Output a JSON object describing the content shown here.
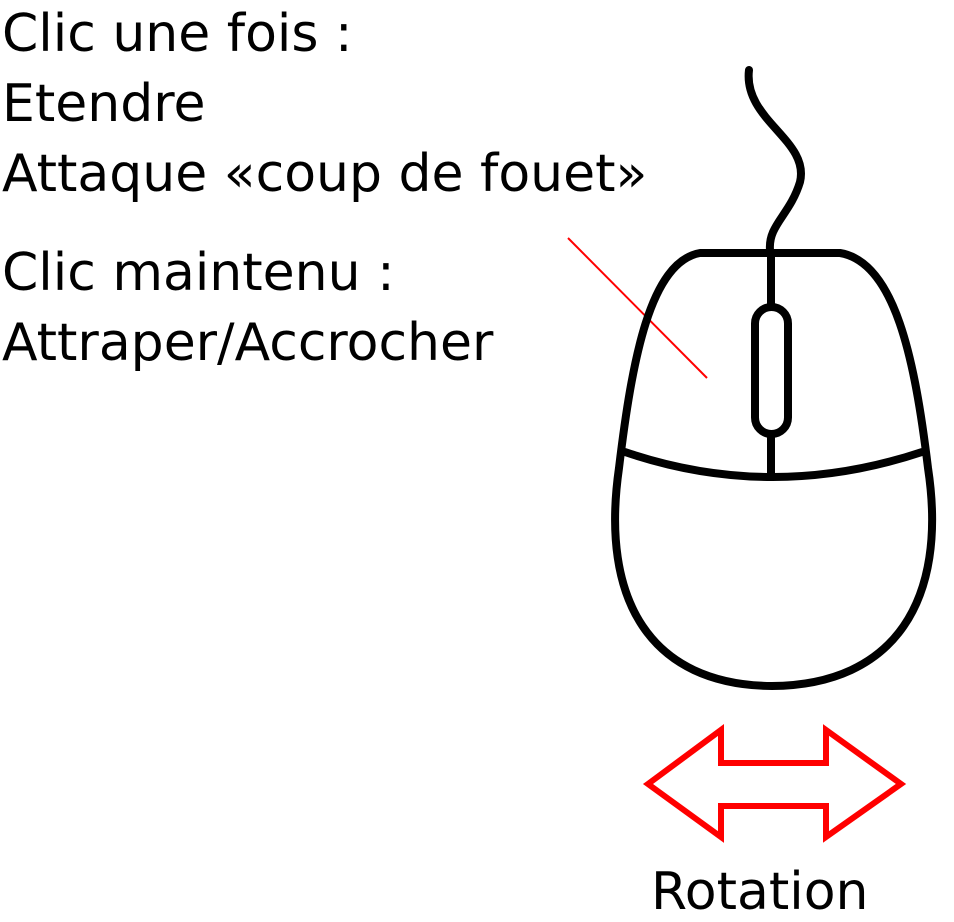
{
  "left_click": {
    "single": {
      "title": "Clic une fois :",
      "action1": "Etendre",
      "action2": "Attaque «coup de fouet»"
    },
    "hold": {
      "title": "Clic maintenu :",
      "action": "Attraper/Accrocher"
    }
  },
  "movement": {
    "label": "Rotation"
  },
  "icons": {
    "mouse": "computer-mouse-icon",
    "pointer": "left-button-pointer-line",
    "arrow": "double-headed-arrow-icon"
  },
  "colors": {
    "text": "#000000",
    "accent": "#ff0000",
    "outline": "#000000",
    "background": "#ffffff"
  }
}
